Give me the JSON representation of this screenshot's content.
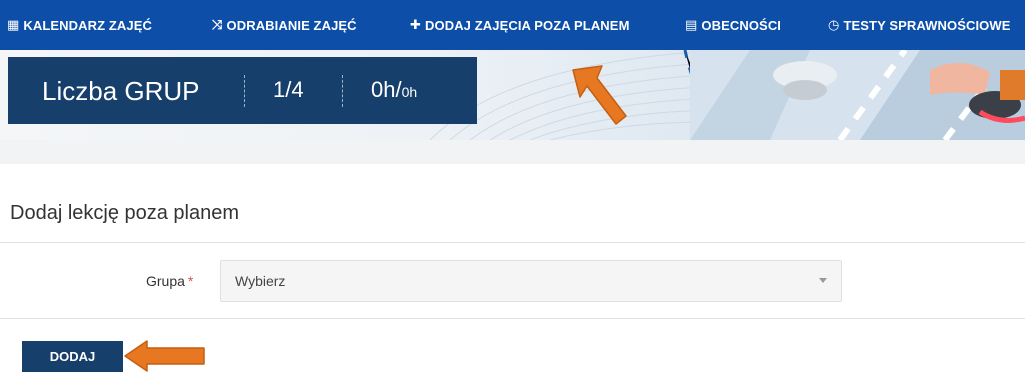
{
  "nav": {
    "items": [
      {
        "label": "KALENDARZ ZAJĘĆ",
        "icon": "calendar-icon",
        "glyph": "▦"
      },
      {
        "label": "ODRABIANIE ZAJĘĆ",
        "icon": "shuffle-icon",
        "glyph": "⤨"
      },
      {
        "label": "DODAJ ZAJĘCIA POZA PLANEM",
        "icon": "plus-icon",
        "glyph": "✚"
      },
      {
        "label": "OBECNOŚCI",
        "icon": "list-icon",
        "glyph": "▤"
      },
      {
        "label": "TESTY SPRAWNOŚCIOWE",
        "icon": "clock-icon",
        "glyph": "◷"
      }
    ]
  },
  "stats": {
    "title": "Liczba GRUP",
    "groups": "1/4",
    "hours": "0h/",
    "hours_small": "0h"
  },
  "form": {
    "title": "Dodaj lekcję poza planem",
    "group_label": "Grupa",
    "required_mark": "*",
    "group_select_value": "Wybierz",
    "submit_label": "DODAJ"
  },
  "colors": {
    "nav_bg": "#0d4fa8",
    "stats_bg": "#173f6b",
    "button_bg": "#173f6b",
    "arrow": "#e87722"
  }
}
